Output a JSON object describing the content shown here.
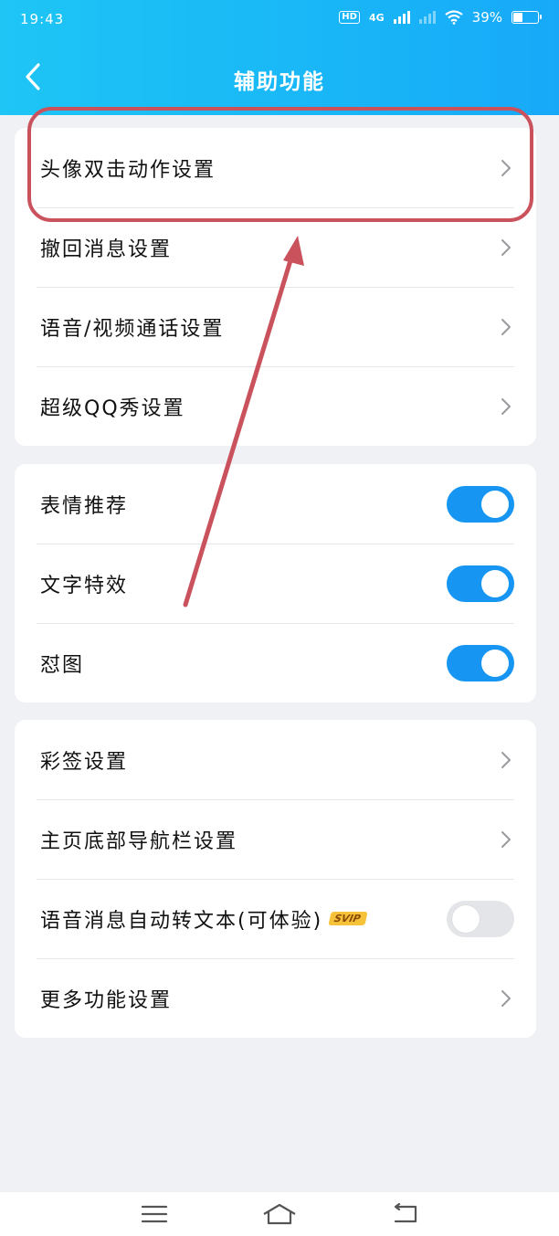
{
  "status_bar": {
    "time": "19:43",
    "hd": "HD",
    "network": "4G",
    "battery_text": "39%",
    "battery_level": 0.39
  },
  "nav": {
    "title": "辅助功能",
    "back_icon": "chevron-left-icon"
  },
  "groups": [
    {
      "items": [
        {
          "label": "头像双击动作设置",
          "control": "chevron"
        },
        {
          "label": "撤回消息设置",
          "control": "chevron"
        },
        {
          "label": "语音/视频通话设置",
          "control": "chevron"
        },
        {
          "label": "超级QQ秀设置",
          "control": "chevron"
        }
      ]
    },
    {
      "items": [
        {
          "label": "表情推荐",
          "control": "toggle",
          "on": true
        },
        {
          "label": "文字特效",
          "control": "toggle",
          "on": true
        },
        {
          "label": "怼图",
          "control": "toggle",
          "on": true
        }
      ]
    },
    {
      "items": [
        {
          "label": "彩签设置",
          "control": "chevron"
        },
        {
          "label": "主页底部导航栏设置",
          "control": "chevron"
        },
        {
          "label": "语音消息自动转文本(可体验)",
          "badge": "SVIP",
          "control": "toggle",
          "on": false
        },
        {
          "label": "更多功能设置",
          "control": "chevron"
        }
      ]
    }
  ],
  "colors": {
    "header_gradient_start": "#1ec5f5",
    "header_gradient_end": "#17a9f8",
    "toggle_on": "#1696f2",
    "toggle_off": "#e4e5e9",
    "annotation_red": "#c9525c",
    "svip_gold": "#f6c23a"
  },
  "system_nav": {
    "icons": [
      "menu-icon",
      "home-icon",
      "back-icon"
    ]
  }
}
